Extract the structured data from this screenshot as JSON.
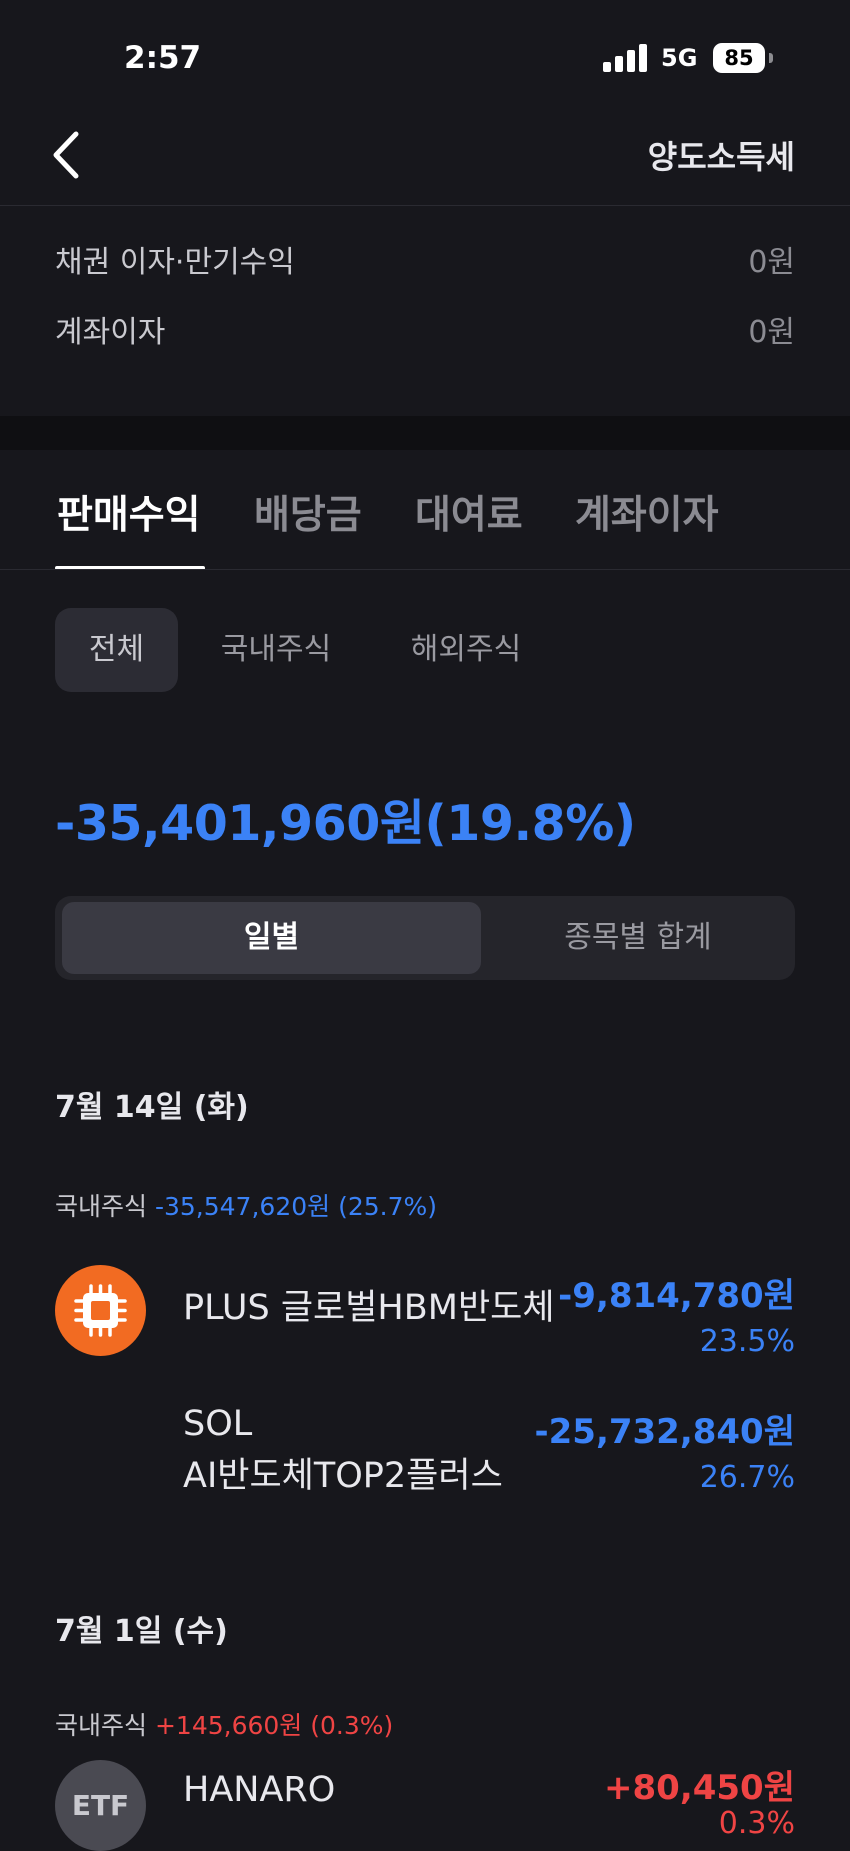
{
  "status_bar": {
    "time": "2:57",
    "network": "5G",
    "battery": "85"
  },
  "header": {
    "title": "양도소득세",
    "back_icon": "chevron-left-icon"
  },
  "summary": [
    {
      "label": "채권 이자·만기수익",
      "value": "0원"
    },
    {
      "label": "계좌이자",
      "value": "0원"
    }
  ],
  "tabs": [
    {
      "label": "판매수익",
      "active": true
    },
    {
      "label": "배당금",
      "active": false
    },
    {
      "label": "대여료",
      "active": false
    },
    {
      "label": "계좌이자",
      "active": false
    }
  ],
  "filters": [
    {
      "label": "전체",
      "active": true
    },
    {
      "label": "국내주식",
      "active": false
    },
    {
      "label": "해외주식",
      "active": false
    }
  ],
  "total": "-35,401,960원(19.8%)",
  "segments": [
    {
      "label": "일별",
      "active": true
    },
    {
      "label": "종목별 합계",
      "active": false
    }
  ],
  "days": [
    {
      "date": "7월 14일 (화)",
      "group_label": "국내주식",
      "group_value": "-35,547,620원 (25.7%)",
      "items": [
        {
          "name": "PLUS 글로벌HBM반도체",
          "amount": "-9,814,780원",
          "rate": "23.5%",
          "icon": "chip-icon"
        },
        {
          "name_line1": "SOL",
          "name_line2": "AI반도체TOP2플러스",
          "amount": "-25,732,840원",
          "rate": "26.7%"
        }
      ]
    },
    {
      "date": "7월 1일 (수)",
      "group_label": "국내주식",
      "group_value": "+145,660원 (0.3%)",
      "items": [
        {
          "name": "HANARO",
          "amount": "+80,450원",
          "rate": "0.3%",
          "icon_text": "ETF"
        }
      ]
    }
  ],
  "colors": {
    "background": "#17171c",
    "negative": "#3b82f6",
    "positive": "#ef4444",
    "chip_orange": "#f26b22"
  }
}
